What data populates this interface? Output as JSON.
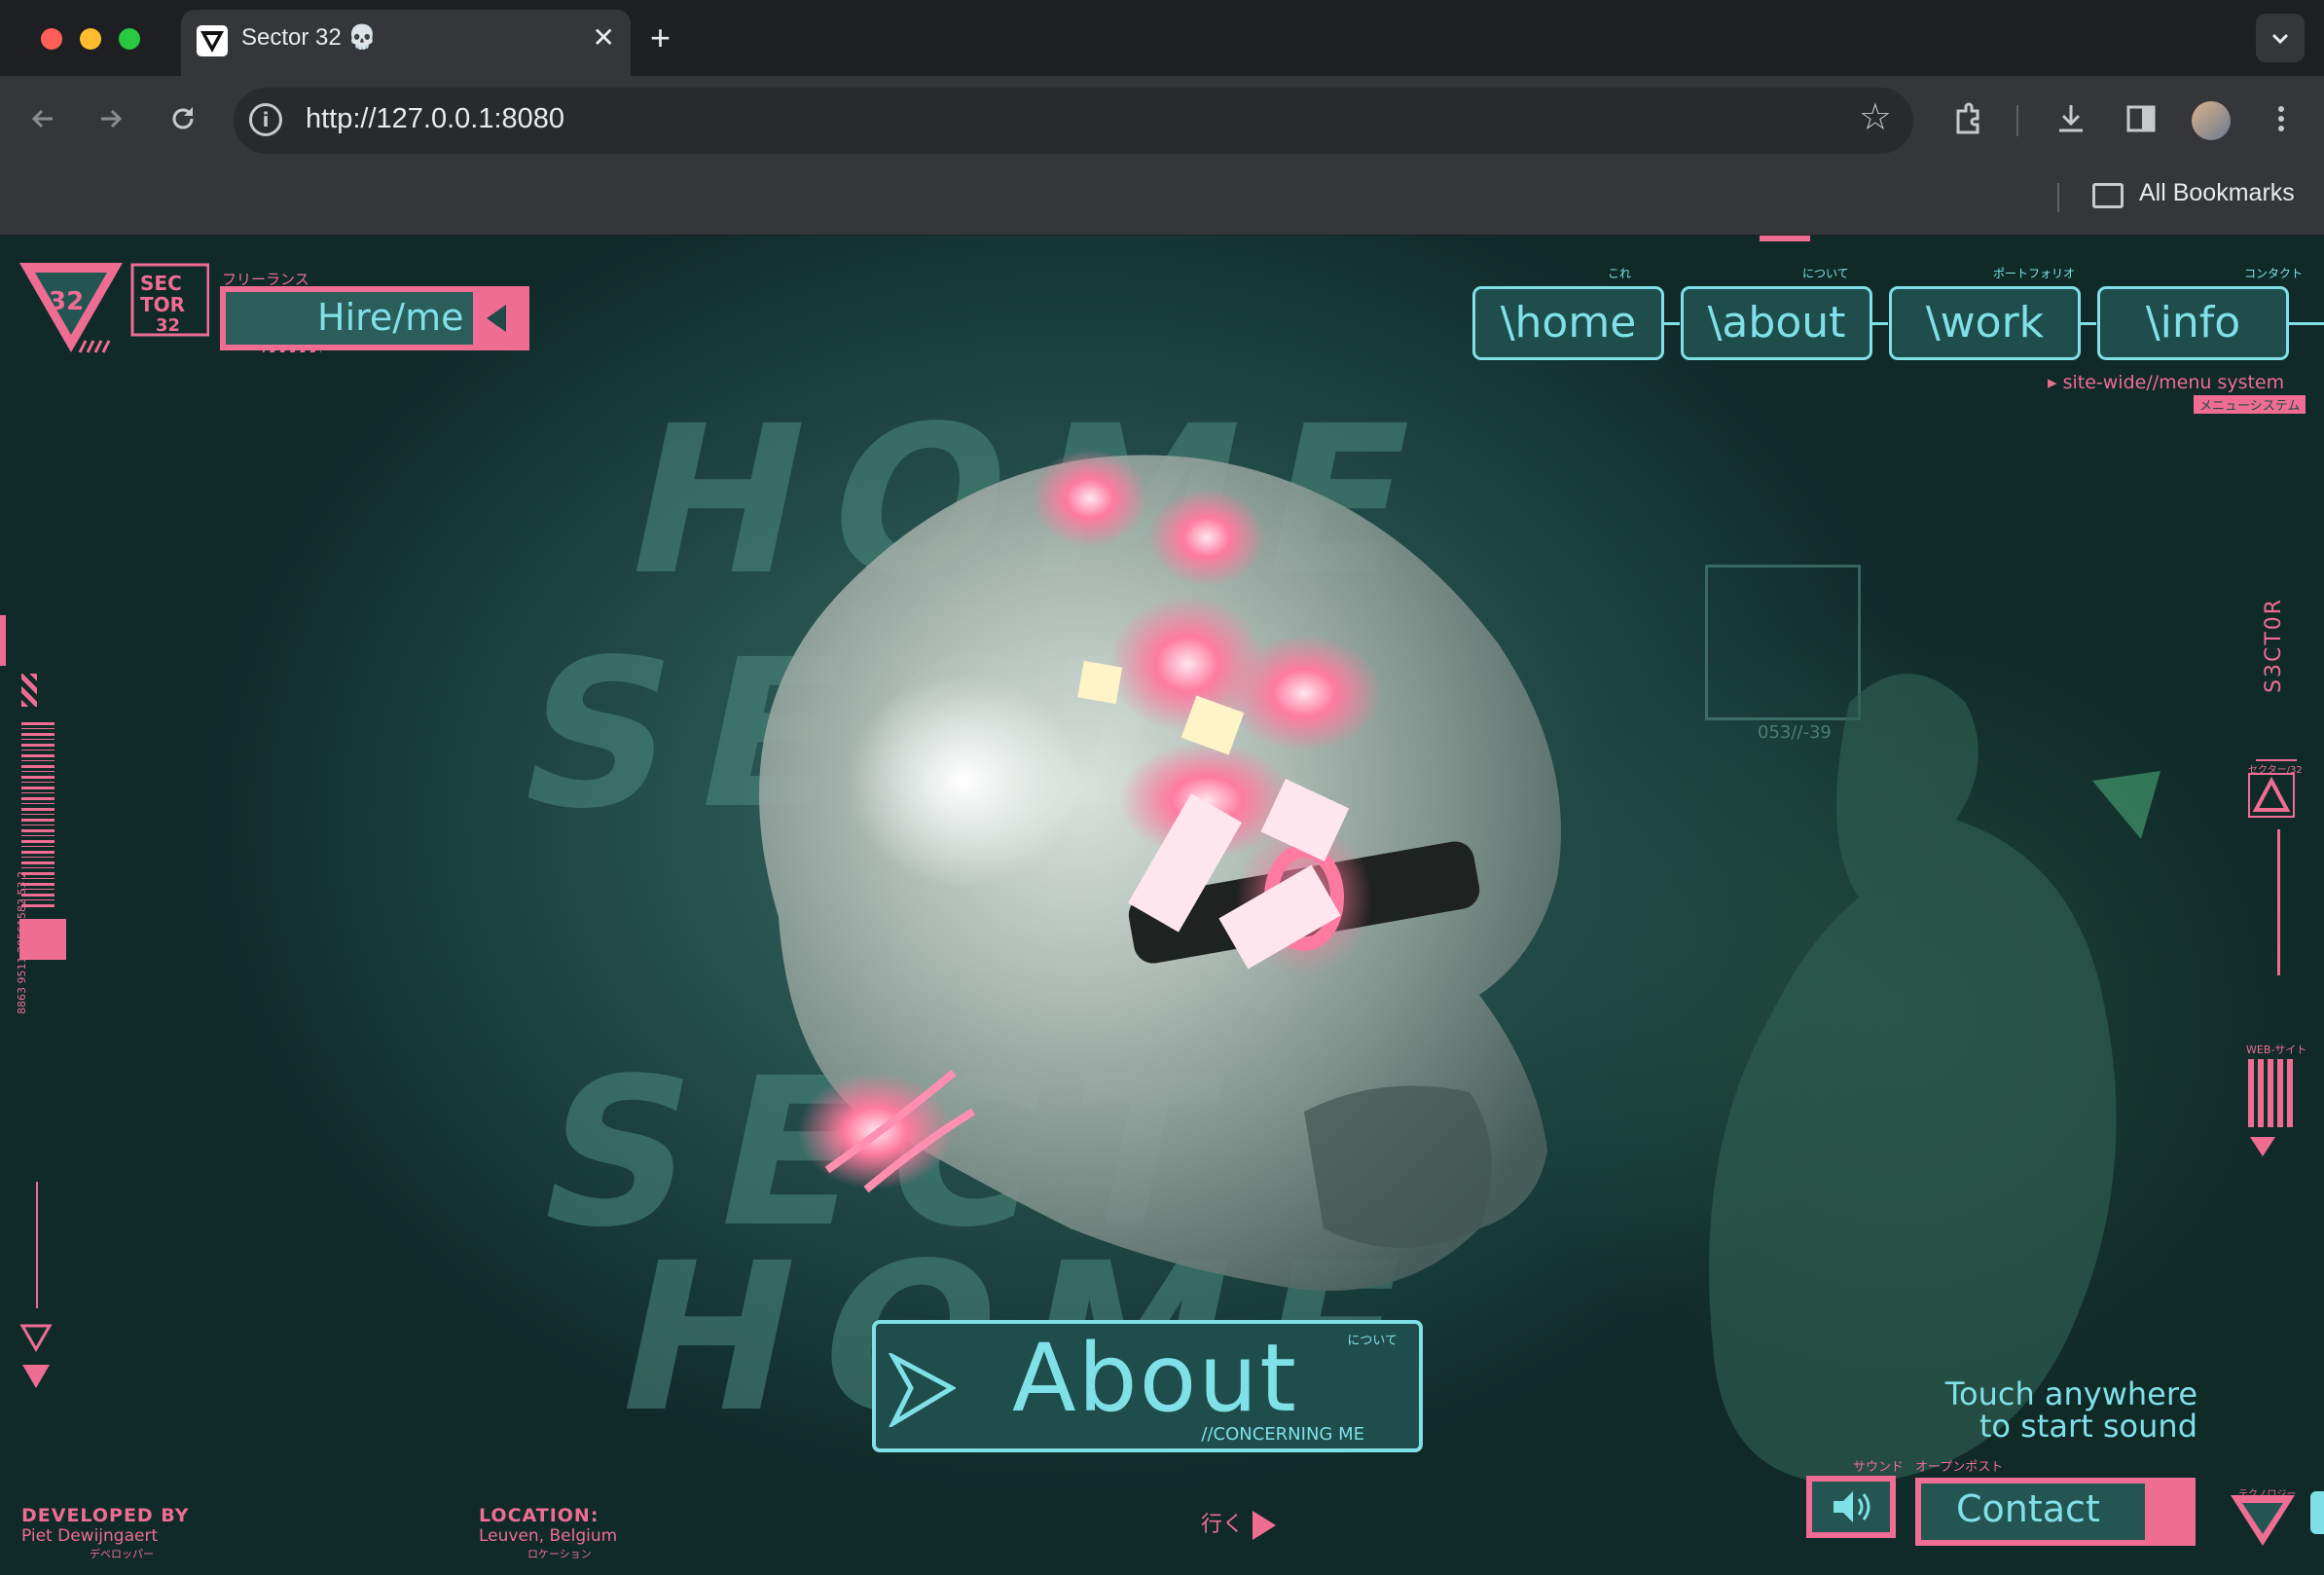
{
  "browser": {
    "tab_title": "Sector 32 💀",
    "new_tab": "+",
    "close_tab": "✕",
    "url": "http://127.0.0.1:8080",
    "bookmarks_label": "All Bookmarks",
    "tab_menu": "⌄"
  },
  "site": {
    "logo_text": "SEC TOR 32",
    "hire_jp": "フリーランス",
    "hire_label": "Hire/me",
    "nav": [
      {
        "label": "\\home",
        "jp": "これ"
      },
      {
        "label": "\\about",
        "jp": "について"
      },
      {
        "label": "\\work",
        "jp": "ポートフォリオ"
      },
      {
        "label": "\\info",
        "jp": "コンタクト"
      }
    ],
    "sitewide_label": "site-wide//menu system",
    "sitewide_jp": "メニューシステム",
    "bg_words": [
      "HOME",
      "SECT",
      "SECT",
      "HOME"
    ],
    "side_code": "053//-39",
    "right_vertical": "S3CT0R",
    "right_small": "セクター/32",
    "right_jp": "テクノロジー",
    "right_web": "WEB-サイト",
    "about_title": "About",
    "about_sub": "//CONCERNING ME",
    "about_jp": "について",
    "touch_line1": "Touch anywhere",
    "touch_line2": "to start sound",
    "sound_jp": "サウンド",
    "contact_jp": "オープンポスト",
    "contact_label": "Contact",
    "corner_jp": "テクノロジー",
    "developed_title": "DEVELOPED BY",
    "developed_name": "Piet Dewijngaert",
    "developed_jp": "デベロッパー",
    "location_title": "LOCATION:",
    "location_value": "Leuven, Belgium",
    "location_jp": "ロケーション",
    "go_label": "行く",
    "barcode_text": "8863 9511 38561582 53 2"
  },
  "colors": {
    "pink": "#ef6d93",
    "cyan": "#7fe0e7",
    "teal_bg": "#25504c"
  }
}
